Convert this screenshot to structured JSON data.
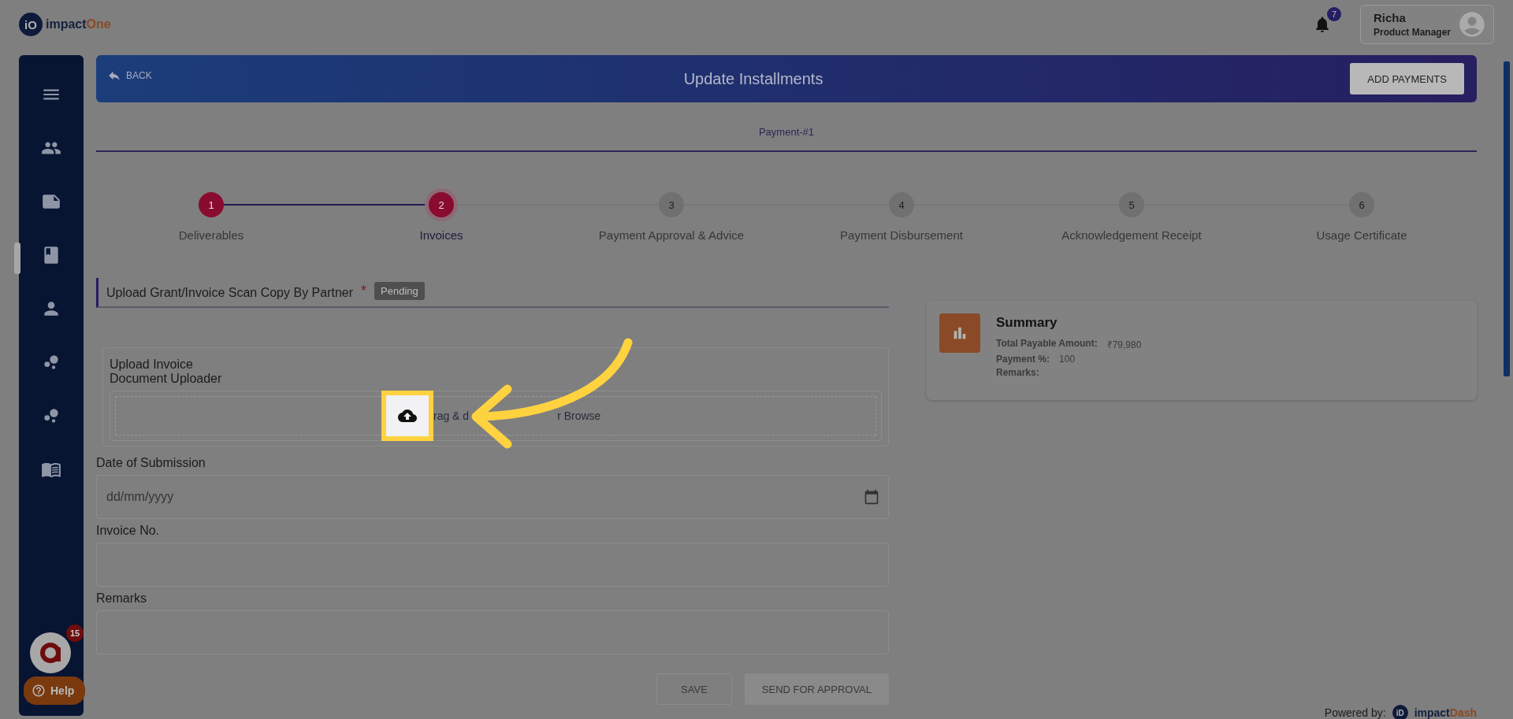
{
  "header": {
    "logo_mark": "iO",
    "logo_text": "impact",
    "logo_accent": "One",
    "notification_count": "7",
    "user": {
      "name": "Richa",
      "role": "Product Manager"
    }
  },
  "sidebar": {
    "items": [
      {
        "selected": false
      },
      {
        "selected": false
      },
      {
        "selected": false
      },
      {
        "selected": true
      },
      {
        "selected": false
      },
      {
        "selected": false
      },
      {
        "selected": false
      },
      {
        "selected": false
      }
    ],
    "chat_badge": "15",
    "help": "Help"
  },
  "banner": {
    "back": "BACK",
    "title": "Update Installments",
    "action": "ADD PAYMENTS"
  },
  "tabs": [
    {
      "label": "Payment-#1",
      "selected": true
    }
  ],
  "steps": [
    {
      "number": "1",
      "label": "Deliverables",
      "completed": true,
      "selected": false
    },
    {
      "number": "2",
      "label": "Invoices",
      "completed": false,
      "selected": true
    },
    {
      "number": "3",
      "label": "Payment Approval & Advice",
      "completed": false,
      "selected": false
    },
    {
      "number": "4",
      "label": "Payment Disbursement",
      "completed": false,
      "selected": false
    },
    {
      "number": "5",
      "label": "Acknowledgement Receipt",
      "completed": false,
      "selected": false
    },
    {
      "number": "6",
      "label": "Usage Certificate",
      "completed": false,
      "selected": false
    }
  ],
  "section": {
    "title": "Upload Grant/Invoice Scan Copy By Partner",
    "required": "*",
    "status": "Pending"
  },
  "upload": {
    "label": "Upload Invoice",
    "sublabel": "Document Uploader",
    "text_parts": [
      "rag & d",
      "r Browse"
    ]
  },
  "fields": [
    {
      "label": "Date of Submission",
      "placeholder": "dd/mm/yyyy",
      "kind": "date"
    },
    {
      "label": "Invoice No.",
      "kind": "text"
    },
    {
      "label": "Remarks",
      "kind": "text"
    }
  ],
  "buttons": [
    {
      "label": "SAVE",
      "kind": "outline",
      "disabled": true
    },
    {
      "label": "SEND FOR APPROVAL",
      "kind": "filled",
      "disabled": true
    }
  ],
  "summary": {
    "title": "Summary",
    "rows": [
      {
        "label": "Total Payable Amount:",
        "value": "₹79,980"
      },
      {
        "label": "Payment %:",
        "value": "100"
      },
      {
        "label": "Remarks:"
      }
    ]
  },
  "footer": {
    "powered_by": "Powered by:",
    "brand_mark": "iD",
    "brand_text": "impact",
    "brand_accent": "Dash"
  }
}
